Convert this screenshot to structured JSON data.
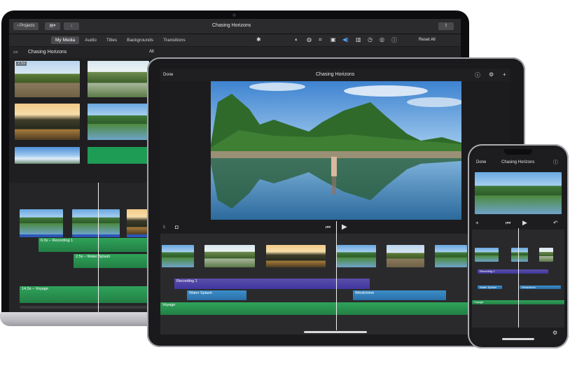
{
  "project_title": "Chasing Horizons",
  "mac": {
    "projects_button": "Projects",
    "share_icon": "share-icon",
    "tabs": [
      "My Media",
      "Audio",
      "Titles",
      "Backgrounds",
      "Transitions"
    ],
    "active_tab": "My Media",
    "reset_all": "Reset All",
    "library_title": "Chasing Horizons",
    "all_label": "All",
    "clip_duration": "2.5s",
    "audio_tracks": [
      {
        "label": "6.0s – Recording 1"
      },
      {
        "label": "2.5s – Water Splash"
      },
      {
        "label": "14.0s – Voyage"
      }
    ]
  },
  "ipad": {
    "done": "Done",
    "tracks": [
      {
        "label": "Recording 1"
      },
      {
        "label": "Water Splash"
      },
      {
        "label": "Windchime"
      },
      {
        "label": "Voyage"
      }
    ]
  },
  "iphone": {
    "done": "Done",
    "tracks": [
      {
        "label": "Recording 1"
      },
      {
        "label": "Water Splash"
      },
      {
        "label": "Windchime"
      },
      {
        "label": "Voyage"
      }
    ]
  },
  "colors": {
    "video_audio_purple": "#4a3fa8",
    "audio_blue": "#3c8ec9",
    "audio_green": "#22a357"
  }
}
